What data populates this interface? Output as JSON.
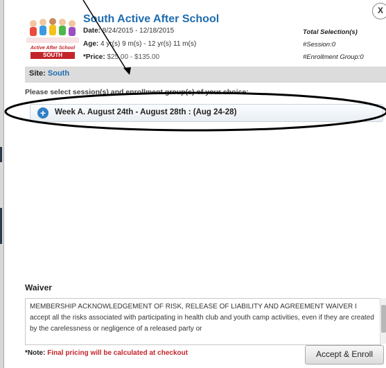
{
  "close_label": "X",
  "logo": {
    "text": "Active After School",
    "badge": "SOUTH"
  },
  "program": {
    "title": "South Active After School",
    "date_label": "Date:",
    "date_value": "8/24/2015 - 12/18/2015",
    "age_label": "Age:",
    "age_value": "4 yr(s) 9 m(s) - 12 yr(s) 11 m(s)",
    "price_label": "*Price:",
    "price_value": "$25.00 - $135.00"
  },
  "selection_summary": {
    "title": "Total Selection(s)",
    "sessions": "#Session:0",
    "enrollment_groups": "#Enrollment Group:0"
  },
  "site": {
    "label": "Site:",
    "value": "South"
  },
  "instruction": "Please select session(s) and enrollment group(s) of your choice:",
  "sessions": [
    {
      "label": "Week A. August 24th - August 28th : (Aug 24-28)",
      "icon": "plus-circle-icon"
    }
  ],
  "waiver": {
    "heading": "Waiver",
    "text": "MEMBERSHIP ACKNOWLEDGEMENT OF RISK, RELEASE OF LIABILITY AND AGREEMENT WAIVER I accept all the risks associated with participating in health club and youth camp activities, even if they are created by the carelessness or negligence of a released party or"
  },
  "note": {
    "label": "*Note:",
    "text": "Final pricing will be calculated at checkout"
  },
  "enroll_button": "Accept & Enroll",
  "colors": {
    "title_blue": "#1e6cb0",
    "note_red": "#c2252b",
    "site_bar": "#dcdcdc"
  }
}
